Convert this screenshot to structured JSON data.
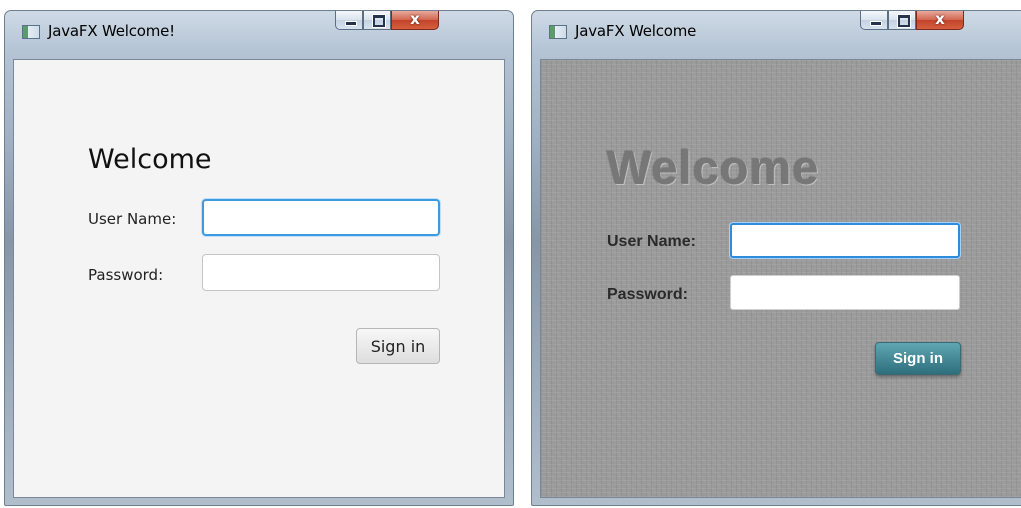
{
  "left_window": {
    "title": "JavaFX Welcome!",
    "icon": "java-app-icon",
    "controls": {
      "minimize_icon": "minimize-icon",
      "maximize_icon": "maximize-icon",
      "close_glyph": "x"
    },
    "form": {
      "heading": "Welcome",
      "username_label": "User Name:",
      "username_value": "",
      "password_label": "Password:",
      "password_value": "",
      "signin_label": "Sign in"
    },
    "colors": {
      "background": "#f4f4f4",
      "focus_ring": "#3e9ae0"
    }
  },
  "right_window": {
    "title": "JavaFX Welcome",
    "icon": "java-app-icon",
    "controls": {
      "minimize_icon": "minimize-icon",
      "maximize_icon": "maximize-icon",
      "close_glyph": "x"
    },
    "form": {
      "heading": "Welcome",
      "username_label": "User Name:",
      "username_value": "",
      "password_label": "Password:",
      "password_value": "",
      "signin_label": "Sign in"
    },
    "colors": {
      "background": "#9a9a9a",
      "button": "#3f8794",
      "focus_ring": "#2f8bdc"
    }
  }
}
